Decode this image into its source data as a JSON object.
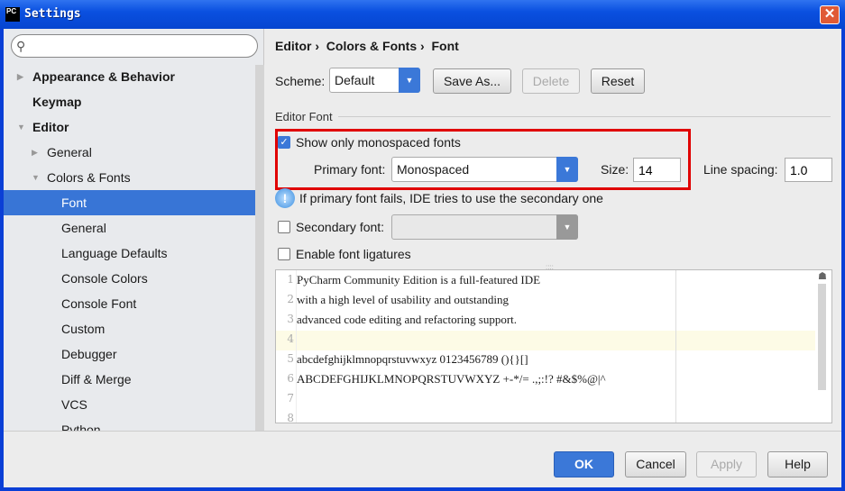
{
  "window": {
    "title": "Settings",
    "app_icon": "PC"
  },
  "search": {
    "placeholder": ""
  },
  "sidebar": {
    "items": [
      {
        "label": "Appearance & Behavior",
        "level": 0,
        "arrow": "right",
        "bold": true
      },
      {
        "label": "Keymap",
        "level": 0,
        "arrow": "",
        "bold": true
      },
      {
        "label": "Editor",
        "level": 0,
        "arrow": "down",
        "bold": true
      },
      {
        "label": "General",
        "level": 1,
        "arrow": "right"
      },
      {
        "label": "Colors & Fonts",
        "level": 1,
        "arrow": "down"
      },
      {
        "label": "Font",
        "level": 2,
        "selected": true
      },
      {
        "label": "General",
        "level": 2
      },
      {
        "label": "Language Defaults",
        "level": 2
      },
      {
        "label": "Console Colors",
        "level": 2
      },
      {
        "label": "Console Font",
        "level": 2
      },
      {
        "label": "Custom",
        "level": 2
      },
      {
        "label": "Debugger",
        "level": 2
      },
      {
        "label": "Diff & Merge",
        "level": 2
      },
      {
        "label": "VCS",
        "level": 2
      },
      {
        "label": "Python",
        "level": 2
      }
    ]
  },
  "breadcrumb": [
    "Editor",
    "Colors & Fonts",
    "Font"
  ],
  "scheme": {
    "label": "Scheme:",
    "value": "Default",
    "save_as": "Save As...",
    "delete": "Delete",
    "reset": "Reset"
  },
  "editor_font": {
    "section": "Editor Font",
    "mono_only_label": "Show only monospaced fonts",
    "mono_only_checked": true,
    "primary_label": "Primary font:",
    "primary_value": "Monospaced",
    "size_label": "Size:",
    "size_value": "14",
    "spacing_label": "Line spacing:",
    "spacing_value": "1.0",
    "info": "If primary font fails, IDE tries to use the secondary one",
    "secondary_label": "Secondary font:",
    "secondary_checked": false,
    "secondary_value": "",
    "ligatures_label": "Enable font ligatures",
    "ligatures_checked": false
  },
  "preview": {
    "lines": [
      "PyCharm Community Edition is a full-featured IDE",
      "with a high level of usability and outstanding",
      "advanced code editing and refactoring support.",
      "",
      "abcdefghijklmnopqrstuvwxyz 0123456789 (){}[]",
      "ABCDEFGHIJKLMNOPQRSTUVWXYZ +-*/= .,;:!? #&$%@|^",
      "",
      ""
    ],
    "line_numbers": [
      "1",
      "2",
      "3",
      "4",
      "5",
      "6",
      "7",
      "8"
    ]
  },
  "buttons": {
    "ok": "OK",
    "cancel": "Cancel",
    "apply": "Apply",
    "help": "Help"
  },
  "colors": {
    "accent": "#3875d6",
    "highlight": "#e00000",
    "title_bar": "#0a50e0"
  }
}
